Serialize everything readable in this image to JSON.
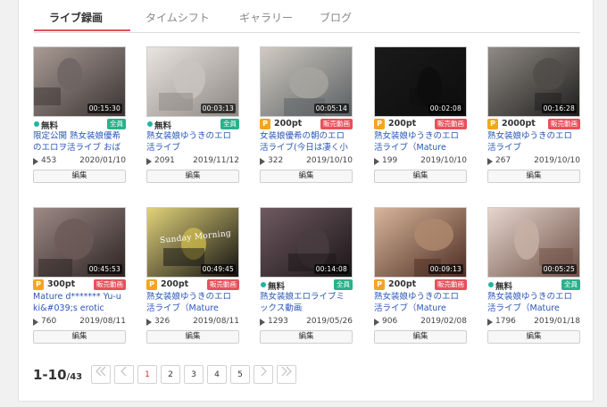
{
  "tabs": [
    {
      "label": "ライブ録画",
      "active": true
    },
    {
      "label": "タイムシフト",
      "active": false
    },
    {
      "label": "ギャラリー",
      "active": false
    },
    {
      "label": "ブログ",
      "active": false
    }
  ],
  "videos": [
    {
      "duration": "00:15:30",
      "price": "無料",
      "price_type": "free",
      "badge": "全員",
      "title": "限定公開 熟女装娘優希のエロヲ活ライブ おば",
      "views": "453",
      "date": "2020/01/10",
      "edit": "編集"
    },
    {
      "duration": "00:03:13",
      "price": "無料",
      "price_type": "free",
      "badge": "全員",
      "title": "熟女装娘ゆうきのエロ活ライブ",
      "views": "2091",
      "date": "2019/11/12",
      "edit": "編集"
    },
    {
      "duration": "00:05:14",
      "price": "200pt",
      "price_type": "point",
      "badge": "販売動画",
      "title": "女装娘優希の朝のエロ活ライブ(今日は凄く小",
      "views": "322",
      "date": "2019/10/10",
      "edit": "編集"
    },
    {
      "duration": "00:02:08",
      "price": "200pt",
      "price_type": "point",
      "badge": "販売動画",
      "title": "熟女装娘ゆうきのエロ活ライブ（Mature",
      "views": "199",
      "date": "2019/10/10",
      "edit": "編集"
    },
    {
      "duration": "00:16:28",
      "price": "2000pt",
      "price_type": "point",
      "badge": "販売動画",
      "title": "熟女装娘ゆうきのエロ活ライブ",
      "views": "267",
      "date": "2019/10/10",
      "edit": "編集"
    },
    {
      "duration": "00:45:53",
      "price": "300pt",
      "price_type": "point",
      "badge": "販売動画",
      "title": "Mature d******* Yu-uki&#039;s erotic",
      "views": "760",
      "date": "2019/08/11",
      "edit": "編集"
    },
    {
      "duration": "00:49:45",
      "price": "200pt",
      "price_type": "point",
      "badge": "販売動画",
      "title": "熟女装娘ゆうきのエロ活ライブ（Mature",
      "views": "326",
      "date": "2019/08/11",
      "edit": "編集",
      "thumb_text": "Sunday Morning"
    },
    {
      "duration": "00:14:08",
      "price": "無料",
      "price_type": "free",
      "badge": "全員",
      "title": "熟女装娘エロライブミックス動画",
      "views": "1293",
      "date": "2019/05/26",
      "edit": "編集"
    },
    {
      "duration": "00:09:13",
      "price": "200pt",
      "price_type": "point",
      "badge": "販売動画",
      "title": "熟女装娘ゆうきのエロ活ライブ（Mature",
      "views": "906",
      "date": "2019/02/08",
      "edit": "編集"
    },
    {
      "duration": "00:05:25",
      "price": "無料",
      "price_type": "free",
      "badge": "全員",
      "title": "熟女装娘ゆうきのエロ活ライブ（Mature",
      "views": "1796",
      "date": "2019/01/18",
      "edit": "編集"
    }
  ],
  "pagination": {
    "range": "1-10",
    "total": "/43",
    "pages": [
      "1",
      "2",
      "3",
      "4",
      "5"
    ],
    "current": "1"
  },
  "colors": {
    "accent": "#e05262",
    "link": "#2a57b8",
    "free_dot": "#21b3a2",
    "point_icon": "#f3a521",
    "badge_all": "#2bb18a",
    "badge_sale": "#e8505b"
  },
  "icons": {
    "point": "P",
    "play": "play-icon",
    "first": "double-chevron-left-icon",
    "prev": "chevron-left-icon",
    "next": "chevron-right-icon",
    "last": "double-chevron-right-icon"
  }
}
